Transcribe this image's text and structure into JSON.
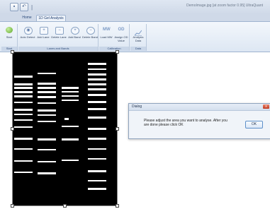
{
  "window": {
    "title": "DemoImage.jpg  [at zoom factor 0.95]  UltraQuant"
  },
  "quick_access": {
    "icons": [
      "save-icon",
      "undo-icon"
    ],
    "separator": "|"
  },
  "tabs": [
    {
      "label": "Home"
    },
    {
      "label": "1D Gel Analysis"
    }
  ],
  "ribbon": {
    "groups": [
      {
        "label": "Start",
        "buttons": [
          {
            "label": "Start",
            "icon": "start-icon"
          }
        ]
      },
      {
        "label": "Lanes and Bands",
        "buttons": [
          {
            "label": "Auto Detect",
            "icon": "auto-detect-icon"
          },
          {
            "label": "Add Lane",
            "icon": "add-lane-icon"
          },
          {
            "label": "Delete Lane",
            "icon": "delete-lane-icon"
          },
          {
            "label": "Add Band",
            "icon": "add-band-icon"
          },
          {
            "label": "Delete Band",
            "icon": "delete-band-icon"
          }
        ]
      },
      {
        "label": "Calibration",
        "buttons": [
          {
            "label": "Load MW",
            "icon": "load-mw-icon",
            "glyph": "MW"
          },
          {
            "label": "Assign OD Value",
            "icon": "assign-od-icon",
            "glyph": "OD"
          }
        ]
      },
      {
        "label": "Data",
        "buttons": [
          {
            "label": "Analysis Data",
            "icon": "analysis-data-icon"
          }
        ]
      }
    ],
    "glyphs": {
      "add": "+",
      "delete": "−"
    }
  },
  "dialog": {
    "title": "Dialog",
    "close_glyph": "x",
    "message": "Please adjust the area you want to analyse.  After you are done please click OK",
    "ok_label": "OK"
  },
  "colors": {
    "accent": "#2b4a7a",
    "gel_background": "#000000",
    "band": "#ffffff",
    "dialog_close": "#c0391f"
  }
}
